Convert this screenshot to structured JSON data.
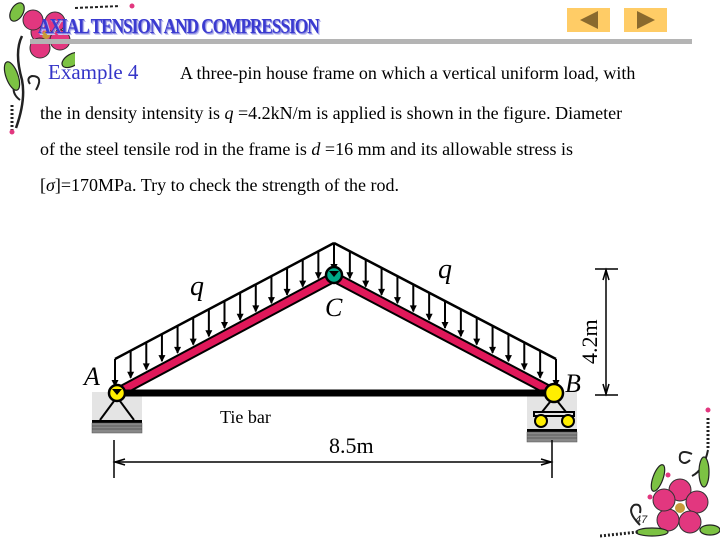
{
  "header": {
    "title": "AXIAL TENSION AND COMPRESSION",
    "nav": {
      "prev_icon": "triangle-left-icon",
      "next_icon": "triangle-right-icon"
    },
    "colors": {
      "title": "#3a3ad0",
      "rule": "#b4b4b4",
      "nav_bg": "#ffcc66",
      "nav_arrow": "#8a6a2e"
    }
  },
  "example": {
    "label": "Example 4",
    "line1": "A three-pin house frame on which a vertical uniform load, with",
    "line2_pre": "the in density intensity is ",
    "line2_var": "q",
    "line2_post": " =4.2kN/m is applied is shown in the figure.  Diameter",
    "line3_pre": "of the steel tensile rod in the frame is  ",
    "line3_var": "d",
    "line3_post": " =16 mm and its allowable stress is",
    "line4_pre": "[",
    "line4_var": "σ",
    "line4_post": "]=170MPa. Try to check the strength of the rod."
  },
  "figure": {
    "labels": {
      "q_left": "q",
      "q_right": "q",
      "pin_a": "A",
      "pin_b": "B",
      "pin_c": "C",
      "tie_bar": "Tie bar",
      "span": "8.5m",
      "height": "4.2m"
    },
    "values": {
      "span_m": 8.5,
      "height_m": 4.2,
      "q_kN_per_m": 4.2
    },
    "colors": {
      "rafter": "#e0185a",
      "pin_ab": "#ffee00",
      "pin_c": "#00aa88",
      "tie": "#000000",
      "support_bg": "#e4e4e4"
    }
  },
  "footer": {
    "page_number": "47"
  },
  "decorations": {
    "top_left": "flower-vine-icon",
    "bottom_right": "flower-vine-icon"
  }
}
